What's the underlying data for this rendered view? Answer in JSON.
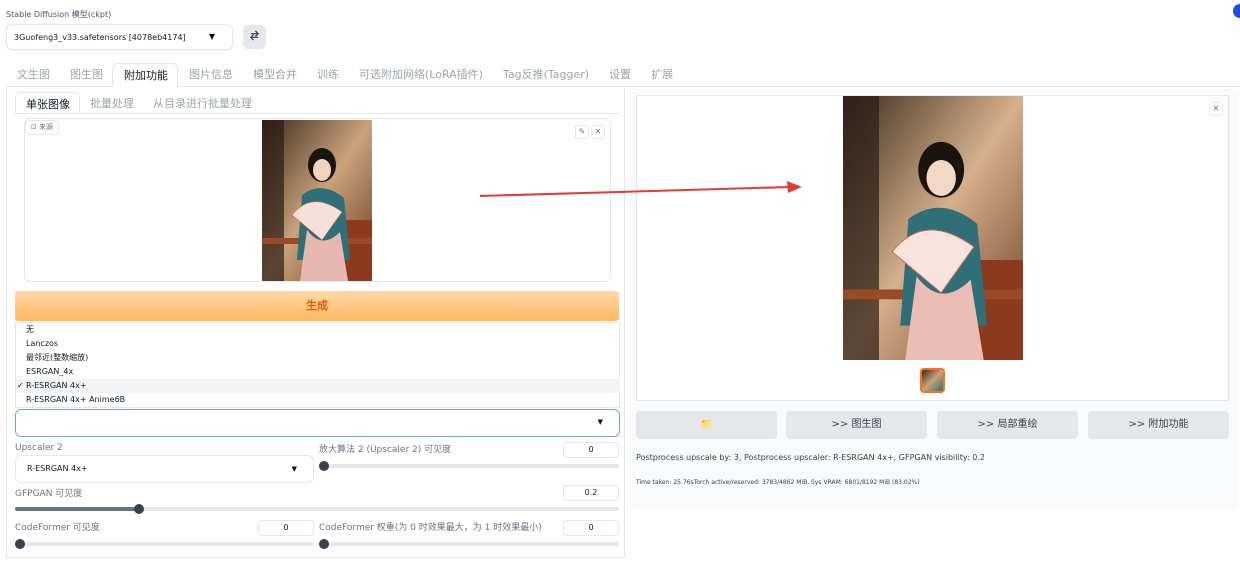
{
  "model": {
    "label": "Stable Diffusion 模型(ckpt)",
    "selected": "3Guofeng3_v33.safetensors [4078eb4174]",
    "refresh_icon": "swap-arrows-icon"
  },
  "tabs": [
    "文生图",
    "图生图",
    "附加功能",
    "图片信息",
    "模型合并",
    "训练",
    "可选附加网络(LoRA插件)",
    "Tag反推(Tagger)",
    "设置",
    "扩展"
  ],
  "active_tab": "附加功能",
  "subtabs": [
    "单张图像",
    "批量处理",
    "从目录进行批量处理"
  ],
  "source": {
    "label": "来源"
  },
  "generate_label": "生成",
  "upscaler_options": [
    "无",
    "Lanczos",
    "最邻近(整数缩放)",
    "ESRGAN_4x",
    "R-ESRGAN 4x+",
    "R-ESRGAN 4x+ Anime6B"
  ],
  "upscaler_checked": "R-ESRGAN 4x+",
  "checkmark": "✓",
  "upscaler2": {
    "label": "Upscaler 2",
    "value": "R-ESRGAN 4x+"
  },
  "upscaler2_visibility": {
    "label": "放大算法 2 (Upscaler 2) 可见度",
    "value": "0",
    "fraction": 0
  },
  "gfpgan": {
    "label": "GFPGAN 可见度",
    "value": "0.2",
    "fraction": 0.2
  },
  "codeformer": {
    "label": "CodeFormer 可见度",
    "value": "0",
    "fraction": 0
  },
  "codeformer_weight": {
    "label": "CodeFormer 权重(为 0 时效果最大，为 1 时效果最小)",
    "value": "0",
    "fraction": 0
  },
  "actions": {
    "folder_icon": "folder-icon",
    "folder_glyph": "📁",
    "to_img2img": ">> 图生图",
    "to_inpaint": ">> 局部重绘",
    "to_extras": ">> 附加功能"
  },
  "output": {
    "info": "Postprocess upscale by: 3, Postprocess upscaler: R-ESRGAN 4x+, GFPGAN visibility: 0.2",
    "timing": "Time taken: 25.76sTorch active/reserved: 3783/4862 MiB, Sys VRAM: 6801/8192 MiB (83.02%)"
  },
  "colors": {
    "accent_orange": "#ffb861",
    "arrow_red": "#e53935",
    "focus_blue": "#60a5fa"
  }
}
